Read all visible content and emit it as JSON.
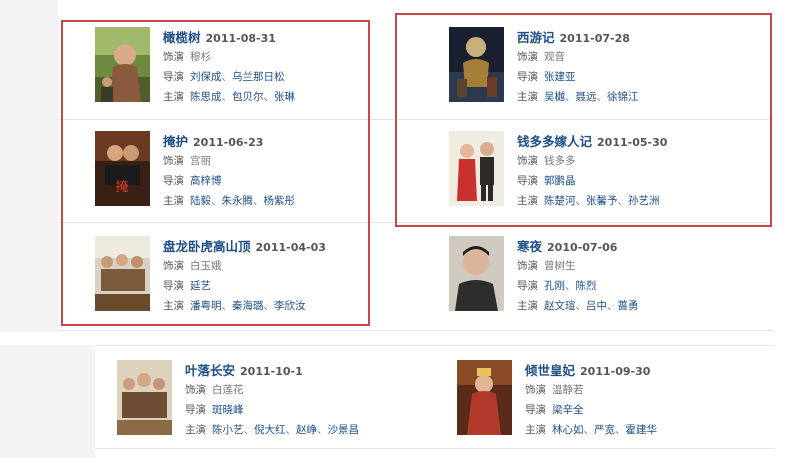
{
  "shows": [
    {
      "title": "橄榄树",
      "date": "2011-08-31",
      "role_label": "饰演",
      "role": "穆杉",
      "director_label": "导演",
      "directors": [
        "刘保成",
        "乌兰那日松"
      ],
      "cast_label": "主演",
      "cast": [
        "陈思成",
        "包贝尔",
        "张琳"
      ]
    },
    {
      "title": "西游记",
      "date": "2011-07-28",
      "role_label": "饰演",
      "role": "观音",
      "director_label": "导演",
      "directors": [
        "张建亚"
      ],
      "cast_label": "主演",
      "cast": [
        "吴樾",
        "聂远",
        "徐锦江"
      ]
    },
    {
      "title": "掩护",
      "date": "2011-06-23",
      "role_label": "饰演",
      "role": "宫丽",
      "director_label": "导演",
      "directors": [
        "高梓博"
      ],
      "cast_label": "主演",
      "cast": [
        "陆毅",
        "朱永腾",
        "杨紫彤"
      ]
    },
    {
      "title": "钱多多嫁人记",
      "date": "2011-05-30",
      "role_label": "饰演",
      "role": "钱多多",
      "director_label": "导演",
      "directors": [
        "郭鹏晶"
      ],
      "cast_label": "主演",
      "cast": [
        "陈楚河",
        "张馨予",
        "孙艺洲"
      ]
    },
    {
      "title": "盘龙卧虎高山顶",
      "date": "2011-04-03",
      "role_label": "饰演",
      "role": "白玉娥",
      "director_label": "导演",
      "directors": [
        "延艺"
      ],
      "cast_label": "主演",
      "cast": [
        "潘粤明",
        "秦海璐",
        "李欣汝"
      ]
    },
    {
      "title": "寒夜",
      "date": "2010-07-06",
      "role_label": "饰演",
      "role": "曾树生",
      "director_label": "导演",
      "directors": [
        "孔刚",
        "陈烈"
      ],
      "cast_label": "主演",
      "cast": [
        "赵文瑄",
        "吕中",
        "蔷勇"
      ]
    },
    {
      "title": "叶落长安",
      "date": "2011-10-1",
      "role_label": "饰演",
      "role": "白莲花",
      "director_label": "导演",
      "directors": [
        "斑晓峰"
      ],
      "cast_label": "主演",
      "cast": [
        "陈小艺",
        "倪大红",
        "赵峥",
        "沙景昌"
      ]
    },
    {
      "title": "倾世皇妃",
      "date": "2011-09-30",
      "role_label": "饰演",
      "role": "温静若",
      "director_label": "导演",
      "directors": [
        "梁辛全"
      ],
      "cast_label": "主演",
      "cast": [
        "林心如",
        "严宽",
        "霍建华"
      ]
    }
  ],
  "colors": {
    "title": "#1d4e85",
    "highlight_box": "#c9474a"
  }
}
